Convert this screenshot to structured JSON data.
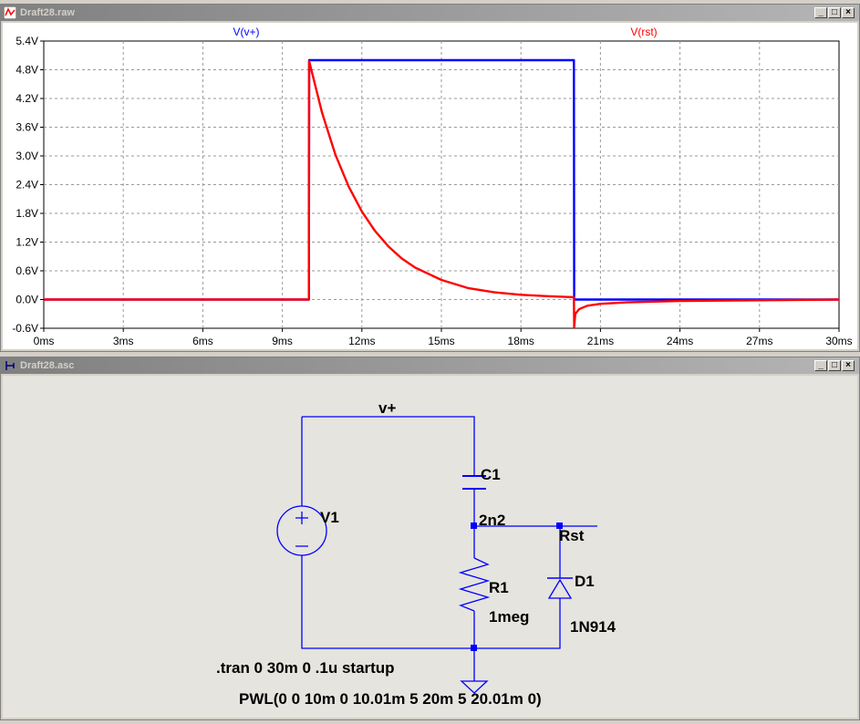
{
  "plot_window": {
    "title": "Draft28.raw",
    "controls": {
      "minimize": "_",
      "restore": "□",
      "close": "×"
    }
  },
  "schematic_window": {
    "title": "Draft28.asc",
    "controls": {
      "minimize": "_",
      "restore": "□",
      "close": "×"
    }
  },
  "colors": {
    "vplus": "#0000ff",
    "vrst": "#ff0000",
    "wire": "#0000ff",
    "node": "#0000ff",
    "grid": "#9a9a9a"
  },
  "chart_data": {
    "type": "line",
    "xlabel": "",
    "ylabel": "",
    "xlim": [
      0,
      30
    ],
    "ylim": [
      -0.6,
      5.4
    ],
    "grid": true,
    "x_ticks": [
      "0ms",
      "3ms",
      "6ms",
      "9ms",
      "12ms",
      "15ms",
      "18ms",
      "21ms",
      "24ms",
      "27ms",
      "30ms"
    ],
    "y_ticks": [
      "5.4V",
      "4.8V",
      "4.2V",
      "3.6V",
      "3.0V",
      "2.4V",
      "1.8V",
      "1.2V",
      "0.6V",
      "0.0V",
      "-0.6V"
    ],
    "legend": [
      "V(v+)",
      "V(rst)"
    ],
    "legend_placement": "top",
    "series": [
      {
        "name": "V(v+)",
        "color": "#0000ff",
        "x": [
          0,
          10,
          10.01,
          20,
          20.01,
          30
        ],
        "y": [
          0,
          0,
          5,
          5,
          0,
          0
        ]
      },
      {
        "name": "V(rst)",
        "color": "#ff0000",
        "x": [
          0,
          10,
          10.01,
          10.5,
          11,
          11.5,
          12,
          12.5,
          13,
          13.5,
          14,
          15,
          16,
          17,
          18,
          19,
          20,
          20.01,
          20.05,
          20.2,
          20.5,
          21,
          22,
          24,
          26,
          28,
          30
        ],
        "y": [
          0,
          0,
          4.98,
          3.9,
          3.03,
          2.36,
          1.84,
          1.43,
          1.11,
          0.86,
          0.67,
          0.41,
          0.24,
          0.15,
          0.1,
          0.07,
          0.05,
          -0.58,
          -0.3,
          -0.2,
          -0.13,
          -0.09,
          -0.06,
          -0.03,
          -0.02,
          -0.01,
          0
        ]
      }
    ]
  },
  "schematic": {
    "net_vplus": "v+",
    "v1_name": "V1",
    "c1_name": "C1",
    "c1_value": "2n2",
    "r1_name": "R1",
    "r1_value": "1meg",
    "d1_name": "D1",
    "d1_value": "1N914",
    "net_rst": "Rst",
    "directive": ".tran 0 30m 0 .1u startup",
    "pwl": "PWL(0 0 10m 0 10.01m 5 20m 5 20.01m 0)"
  }
}
